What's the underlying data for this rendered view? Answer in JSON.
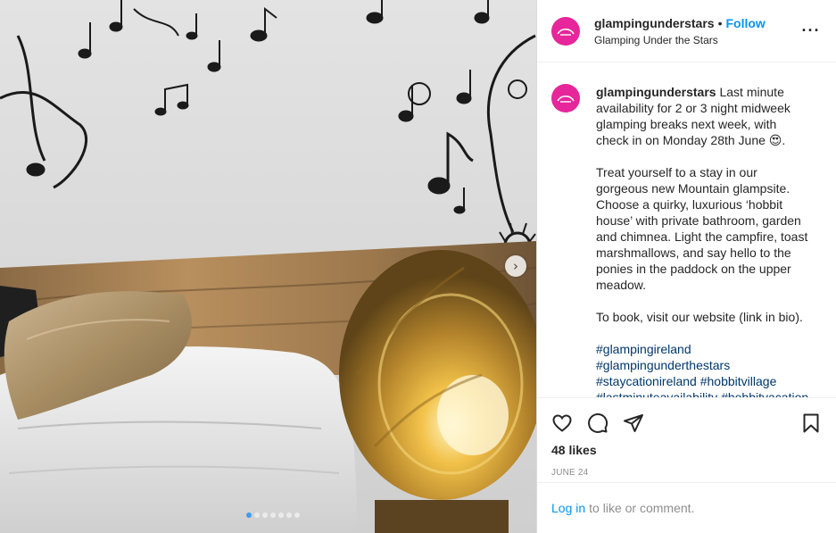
{
  "header": {
    "username": "glampingunderstars",
    "separator": "•",
    "follow_label": "Follow",
    "location": "Glamping Under the Stars",
    "more_icon": "more-horizontal-icon"
  },
  "caption": {
    "username": "glampingunderstars",
    "paragraph1": "Last minute availability for 2 or 3 night midweek glamping breaks next week, with check in on Monday 28th June 😍.",
    "paragraph2": "Treat yourself to a stay in our gorgeous new Mountain glampsite. Choose a quirky, luxurious ‘hobbit house’ with private bathroom, garden and chimnea. Light the campfire, toast marshmallows, and say hello to the ponies in the paddock on the upper meadow.",
    "paragraph3": "To book, visit our website (link in bio).",
    "hashtags": [
      "#glampingireland",
      "#glampingunderthestars",
      "#staycationireland #hobbitvillage",
      "#lastminuteavailability #hobbitvacation"
    ]
  },
  "actions": {
    "like_icon": "heart-icon",
    "comment_icon": "comment-icon",
    "share_icon": "paper-plane-icon",
    "save_icon": "bookmark-icon"
  },
  "likes": "48 likes",
  "date": "JUNE 24",
  "login": {
    "link": "Log in",
    "rest": "to like or comment."
  },
  "carousel": {
    "slide_count": 7,
    "active_index": 0
  },
  "colors": {
    "brand_pink": "#e6269a",
    "link_blue": "#0095f6",
    "hashtag_blue": "#00376b"
  }
}
